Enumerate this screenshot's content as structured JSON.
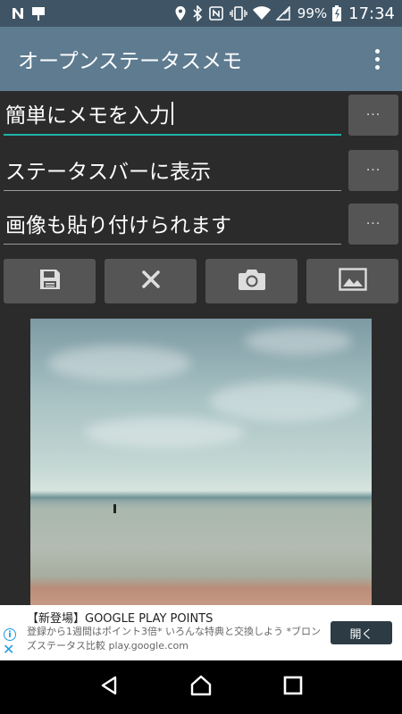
{
  "status_bar": {
    "battery_text": "99%",
    "time": "17:34",
    "icons": [
      "n-notification-icon",
      "flag-notification-icon",
      "location-icon",
      "bluetooth-icon",
      "nfc-icon",
      "vibrate-icon",
      "wifi-icon",
      "signal-icon",
      "battery-icon"
    ]
  },
  "app_bar": {
    "title": "オープンステータスメモ",
    "menu_icon": "overflow-menu-icon"
  },
  "fields": [
    {
      "value": "簡単にメモを入力",
      "button_label": "···"
    },
    {
      "value": "ステータスバーに表示",
      "button_label": "···"
    },
    {
      "value": "画像も貼り付けられます",
      "button_label": "···"
    }
  ],
  "actions": [
    {
      "icon": "save-icon"
    },
    {
      "icon": "clear-icon"
    },
    {
      "icon": "camera-icon"
    },
    {
      "icon": "image-icon"
    }
  ],
  "ad": {
    "title": "【新登場】GOOGLE PLAY POINTS",
    "body": "登録から1週間はポイント3倍* いろんな特典と交換しよう *ブロンズステータス比較 play.google.com",
    "button": "開く"
  },
  "nav": [
    "back-icon",
    "home-icon",
    "recents-icon"
  ],
  "colors": {
    "status_bar": "#3f5566",
    "app_bar": "#5e7b90",
    "background": "#2b2b2b",
    "accent": "#20b2aa",
    "button": "#555555"
  }
}
